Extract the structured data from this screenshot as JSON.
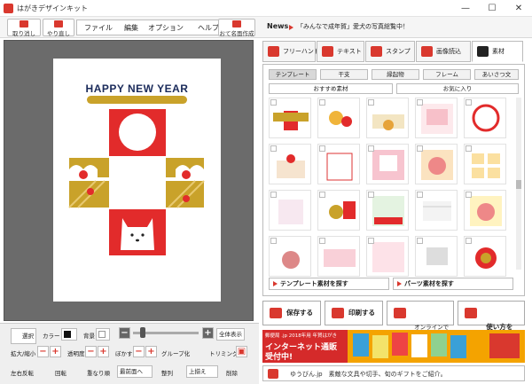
{
  "window": {
    "title": "はがきデザインキット",
    "minimize": "—",
    "maximize": "☐",
    "close": "✕"
  },
  "toolbar": {
    "undo_label": "取り消し",
    "redo_label": "やり直し",
    "menus": [
      "ファイル",
      "編集",
      "オプション",
      "ヘルプ"
    ],
    "address_label": "おて名面作成",
    "news_label": "News",
    "news_text": "「みんなで成年賀」愛犬の写真総覧中！"
  },
  "card": {
    "greeting": "HAPPY NEW YEAR"
  },
  "controls": {
    "select_label": "選択",
    "color_label": "カラー",
    "background_label": "背景",
    "minus": "−",
    "plus": "+",
    "fit_label": "全体表示",
    "zoom_label": "拡大/縮小",
    "opacity_label": "透明度",
    "blur_label": "ぼかす",
    "group_label": "グループ化",
    "trimming_label": "トリミング",
    "flip_label": "左右反転",
    "rotate_label": "回転",
    "order_label": "重なり順",
    "order_value": "最前面へ",
    "align_label": "整列",
    "align_value": "上揃え",
    "delete_label": "削除"
  },
  "tabs": [
    {
      "label": "フリーハンド",
      "color": "#d9382e"
    },
    {
      "label": "テキスト",
      "color": "#d9382e"
    },
    {
      "label": "スタンプ",
      "color": "#d9382e"
    },
    {
      "label": "画像読込",
      "color": "#d9382e"
    },
    {
      "label": "素材",
      "color": "#222222"
    }
  ],
  "material": {
    "subtabs": [
      "テンプレート",
      "干支",
      "縁起物",
      "フレーム",
      "あいさつ文"
    ],
    "recommend_label": "おすすめ素材",
    "favorites_label": "お気に入り",
    "search_template": "テンプレート素材を探す",
    "search_parts": "パーツ素材を探す"
  },
  "actions": {
    "save": "保存する",
    "print": "印刷する",
    "order": "オンラインで\n注文する",
    "video": "使い方を\n映像で見る"
  },
  "banner": {
    "line1": "郵便局 .jp 2018年用 年賀はがき",
    "line2": "インターネット通販",
    "line3": "受付中!"
  },
  "footer": {
    "text": "ゆうびん.jp　素敵な文具や切手、旬のギフトをご紹介。"
  }
}
